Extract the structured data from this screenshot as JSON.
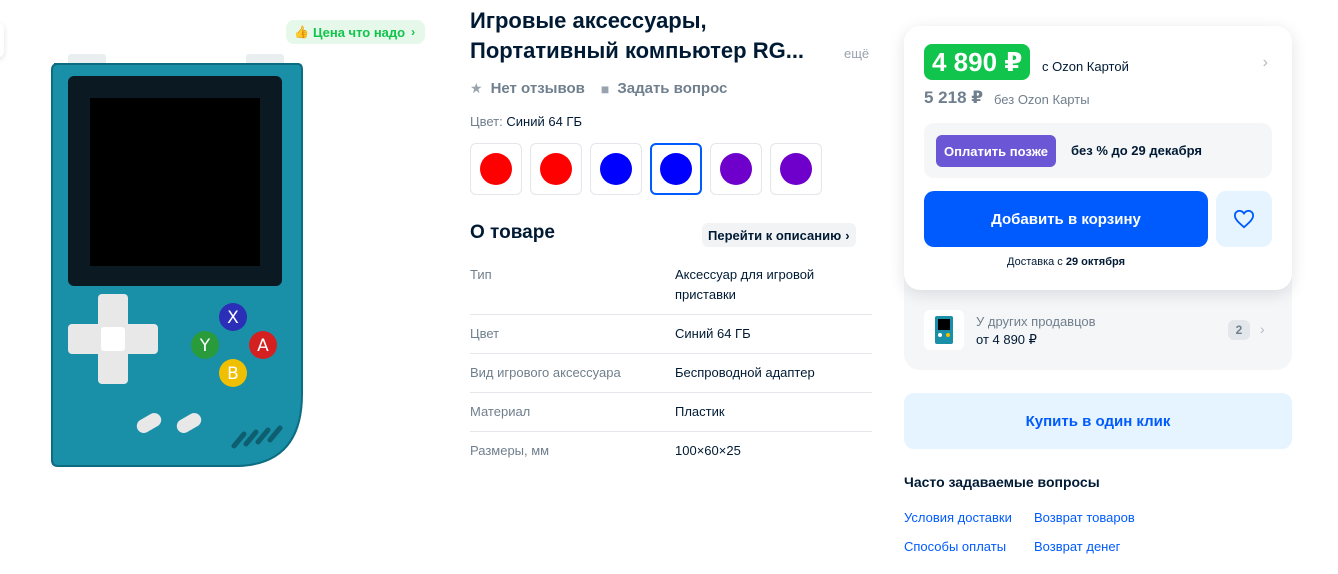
{
  "badge": {
    "label": "Цена что надо"
  },
  "product": {
    "title_line1": "Игровые аксессуары,",
    "title_line2": "Портативный компьютер RG...",
    "more": "ещё",
    "reviews": "Нет отзывов",
    "ask": "Задать вопрос",
    "color_label": "Цвет:",
    "color_value": "Синий 64 ГБ",
    "swatches": [
      {
        "color": "#ff0000",
        "selected": false
      },
      {
        "color": "#ff0000",
        "selected": false
      },
      {
        "color": "#0000ff",
        "selected": false
      },
      {
        "color": "#0000ff",
        "selected": true
      },
      {
        "color": "#6f00cc",
        "selected": false
      },
      {
        "color": "#6f00cc",
        "selected": false
      }
    ]
  },
  "about": {
    "title": "О товаре",
    "link": "Перейти к описанию",
    "specs": [
      {
        "key": "Тип",
        "value": "Аксессуар для игровой приставки"
      },
      {
        "key": "Цвет",
        "value": "Синий 64 ГБ"
      },
      {
        "key": "Вид игрового аксессуара",
        "value": "Беспроводной адаптер"
      },
      {
        "key": "Материал",
        "value": "Пластик"
      },
      {
        "key": "Размеры, мм",
        "value": "100×60×25"
      }
    ]
  },
  "buy": {
    "price_ozon": "4 890 ₽",
    "price_ozon_label": "с Ozon Картой",
    "price_regular": "5 218 ₽",
    "price_regular_label": "без Ozon Карты",
    "paylater_button": "Оплатить позже",
    "paylater_text": "без % до 29 декабря",
    "cart_button": "Добавить в корзину",
    "delivery_prefix": "Доставка с",
    "delivery_date": "29 октября"
  },
  "sellers": {
    "label": "У других продавцов",
    "price": "от 4 890 ₽",
    "count": "2"
  },
  "oneclick": {
    "label": "Купить в один клик"
  },
  "faq": {
    "title": "Часто задаваемые вопросы",
    "links": [
      "Условия доставки",
      "Возврат товаров",
      "Способы оплаты",
      "Возврат денег"
    ]
  },
  "colors": {
    "accent": "#005bff",
    "green": "#10c44c",
    "paylater": "#6b57d6",
    "console": "#1a8fa8"
  }
}
